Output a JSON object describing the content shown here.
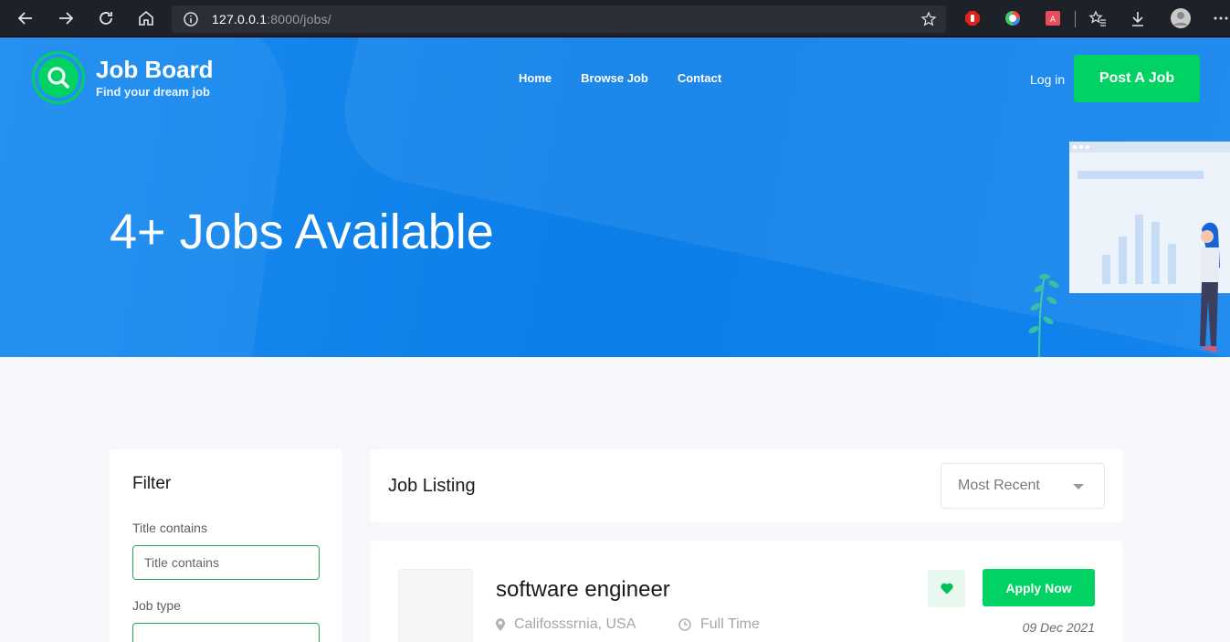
{
  "browser": {
    "url_host": "127.0.0.1",
    "url_path": ":8000/jobs/"
  },
  "brand": {
    "title": "Job Board",
    "tagline": "Find your dream job",
    "accent": "#00d363",
    "hero_blue": "#0b7ee8"
  },
  "nav": {
    "items": [
      "Home",
      "Browse Job",
      "Contact"
    ],
    "login": "Log in",
    "post_job": "Post A Job"
  },
  "hero": {
    "title": "4+ Jobs Available"
  },
  "filter": {
    "heading": "Filter",
    "title_label": "Title contains",
    "title_placeholder": "Title contains",
    "type_label": "Job type"
  },
  "listing": {
    "heading": "Job Listing",
    "sort_value": "Most Recent"
  },
  "jobs": [
    {
      "title": "software engineer",
      "location": "Califosssrnia, USA",
      "type": "Full Time",
      "date": "09 Dec 2021",
      "apply_label": "Apply Now"
    }
  ]
}
